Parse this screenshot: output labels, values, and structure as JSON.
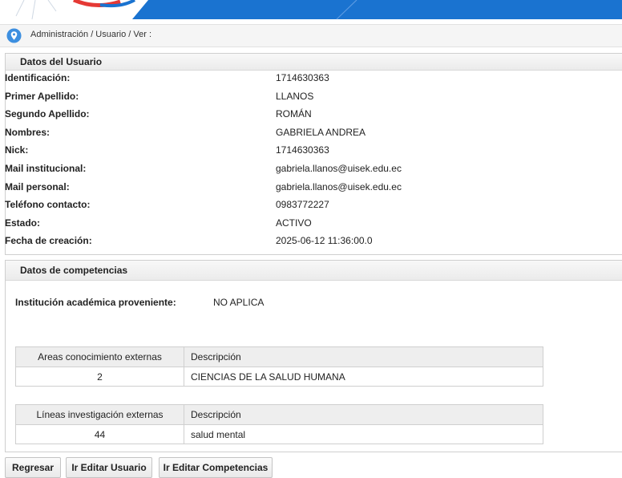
{
  "breadcrumb": {
    "path": "Administración / Usuario / Ver :"
  },
  "user_panel": {
    "title": "Datos del Usuario",
    "fields": [
      {
        "label": "Identificación:",
        "value": "1714630363"
      },
      {
        "label": "Primer Apellido:",
        "value": "LLANOS"
      },
      {
        "label": "Segundo Apellido:",
        "value": "ROMÁN"
      },
      {
        "label": "Nombres:",
        "value": "GABRIELA ANDREA"
      },
      {
        "label": "Nick:",
        "value": "1714630363"
      },
      {
        "label": "Mail institucional:",
        "value": "gabriela.llanos@uisek.edu.ec"
      },
      {
        "label": "Mail personal:",
        "value": "gabriela.llanos@uisek.edu.ec"
      },
      {
        "label": "Teléfono contacto:",
        "value": "0983772227"
      },
      {
        "label": "Estado:",
        "value": "ACTIVO"
      },
      {
        "label": "Fecha de creación:",
        "value": "2025-06-12 11:36:00.0"
      }
    ]
  },
  "competencias_panel": {
    "title": "Datos de competencias",
    "institucion_label": "Institución académica proveniente:",
    "institucion_value": "NO APLICA",
    "areas_table": {
      "headers": [
        "Areas conocimiento externas",
        "Descripción"
      ],
      "rows": [
        [
          "2",
          "CIENCIAS DE LA SALUD HUMANA"
        ]
      ]
    },
    "lineas_table": {
      "headers": [
        "Líneas investigación externas",
        "Descripción"
      ],
      "rows": [
        [
          "44",
          "salud mental"
        ]
      ]
    }
  },
  "buttons": {
    "back": "Regresar",
    "edit_user": "Ir Editar Usuario",
    "edit_competencias": "Ir Editar Competencias"
  },
  "colors": {
    "brand_blue": "#1976d2",
    "brand_red": "#e53935"
  }
}
